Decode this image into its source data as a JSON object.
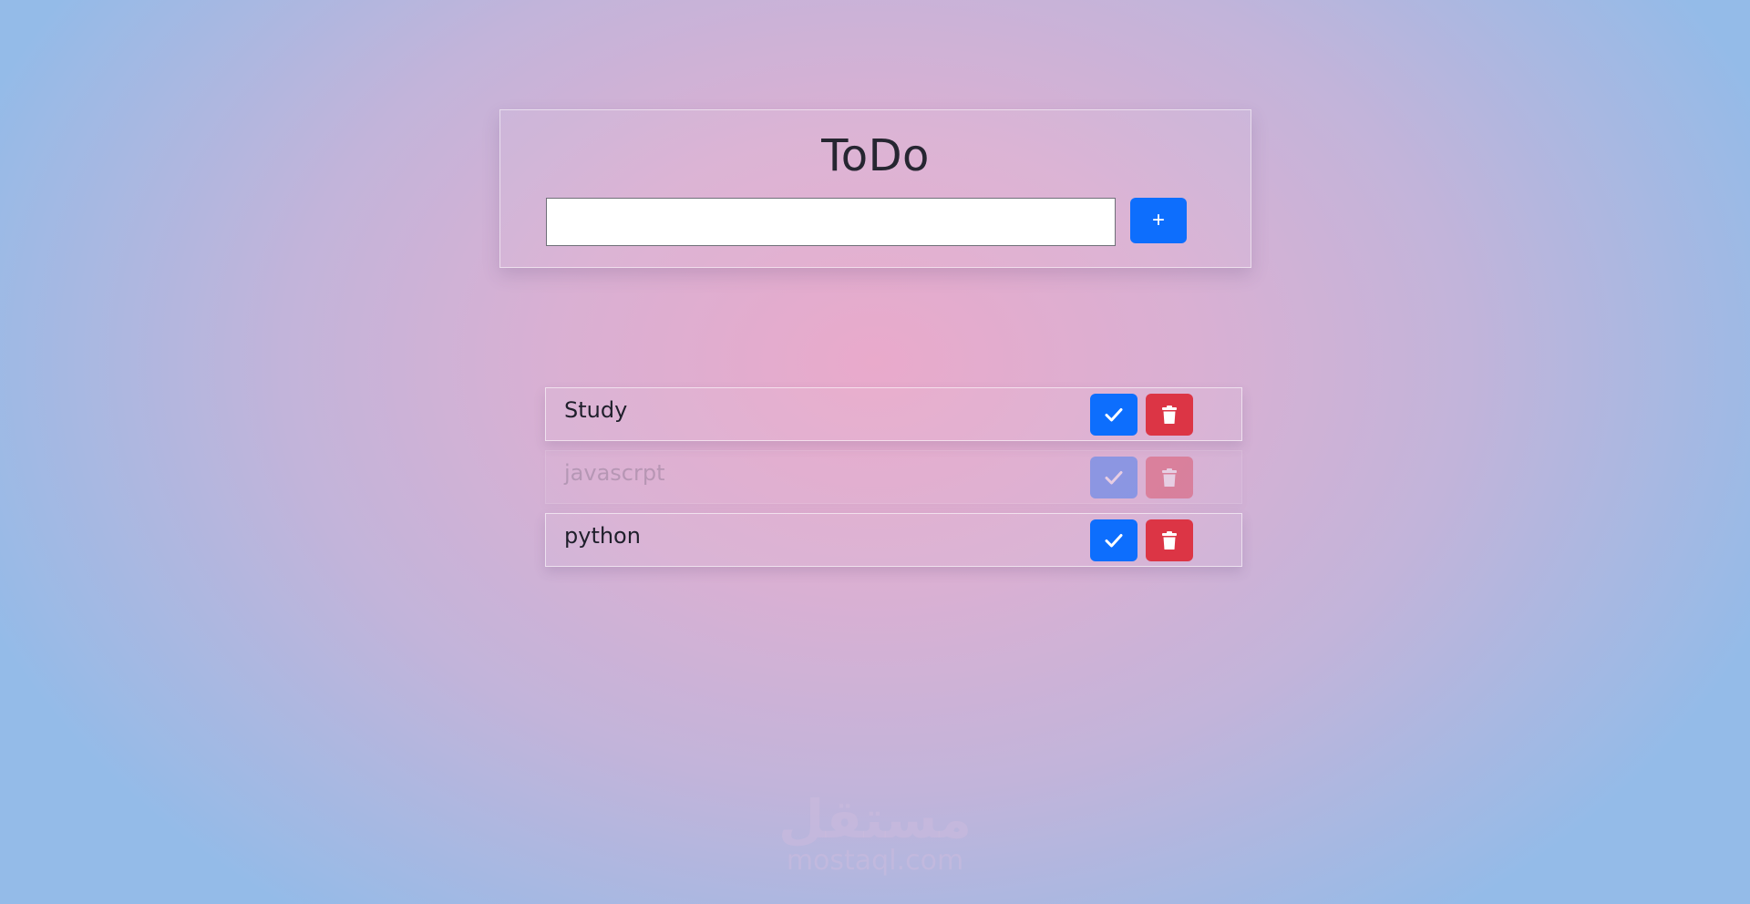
{
  "app": {
    "title": "ToDo"
  },
  "new_todo": {
    "value": "",
    "placeholder": "",
    "add_label": "+"
  },
  "todos": [
    {
      "text": "Study",
      "completed": false
    },
    {
      "text": "javascrpt",
      "completed": true
    },
    {
      "text": "python",
      "completed": false
    }
  ],
  "icons": {
    "add": "plus-icon",
    "complete": "check-icon",
    "delete": "trash-icon"
  },
  "colors": {
    "primary": "#0d6efd",
    "danger": "#dc3545",
    "background_center": "#e9aacb",
    "background_edge": "#94bbe8"
  },
  "watermark": {
    "arabic": "مستقل",
    "latin": "mostaql.com"
  }
}
